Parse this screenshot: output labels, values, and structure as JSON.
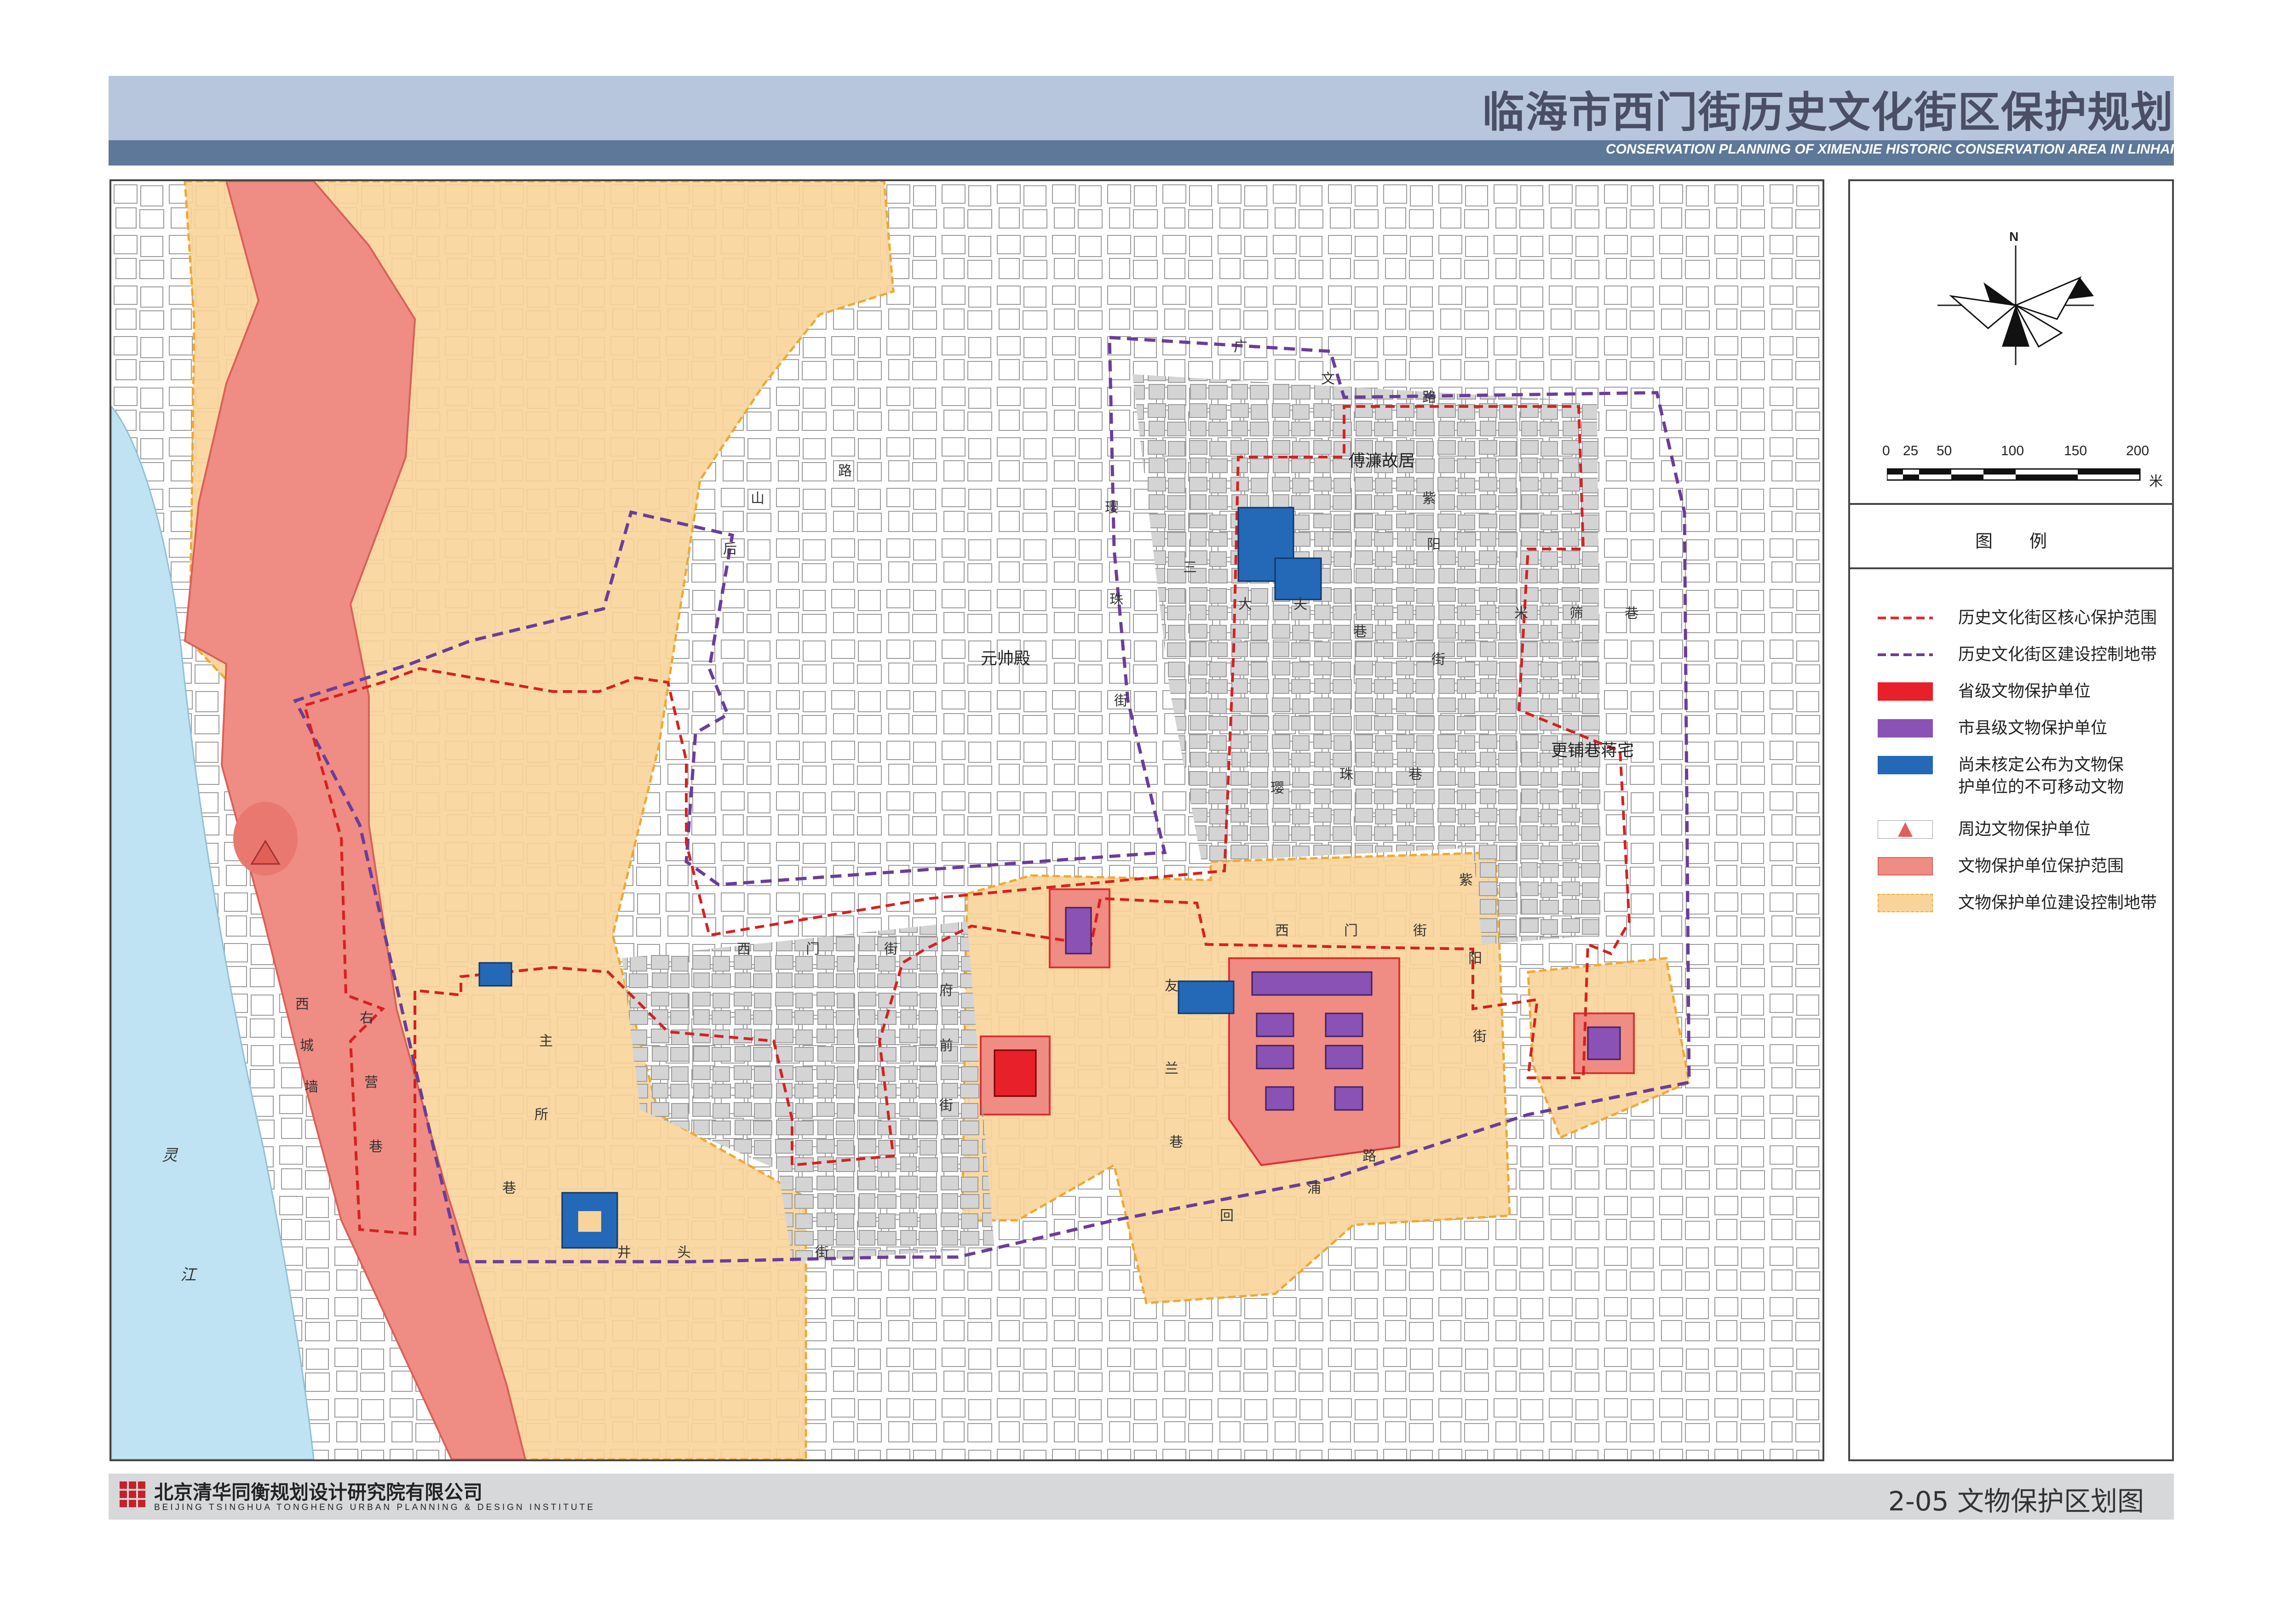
{
  "header": {
    "title": "临海市西门街历史文化街区保护规划",
    "subtitle": "CONSERVATION PLANNING OF XIMENJIE HISTORIC CONSERVATION AREA IN LINHAI"
  },
  "map": {
    "north_label": "N",
    "scale": {
      "ticks": [
        "0",
        "25",
        "50",
        "100",
        "150",
        "200"
      ],
      "unit": "米"
    },
    "place_labels": {
      "yuanshuaidian": "元帅殿",
      "fulianguju": "傅濂故居",
      "gengpuxiang_residence": "更铺巷蒋宅"
    },
    "street_chars": {
      "guangwenlu": [
        "广",
        "文",
        "路"
      ],
      "houshanlu": [
        "山",
        "后",
        "路"
      ],
      "yingzhujie": [
        "璎",
        "珠",
        "街"
      ],
      "sandafuxiang": [
        "三",
        "大",
        "夫",
        "巷"
      ],
      "ziyangjie_n": [
        "紫",
        "阳",
        "街"
      ],
      "migengxiang": [
        "米",
        "筛",
        "巷"
      ],
      "yingzhuxiang": [
        "璎",
        "珠",
        "巷"
      ],
      "ximenjie": [
        "西",
        "门",
        "街"
      ],
      "ziyangjie_s": [
        "紫",
        "阳",
        "街"
      ],
      "xichengqiang": [
        "西",
        "城",
        "墙"
      ],
      "youyingxiang": [
        "右",
        "营",
        "巷"
      ],
      "zhusuoxiang": [
        "主",
        "所",
        "巷"
      ],
      "jingtoujie": [
        "井",
        "头",
        "街"
      ],
      "fuqianjie": [
        "府",
        "前",
        "街"
      ],
      "youlanxiang": [
        "友",
        "兰",
        "巷"
      ],
      "huipulu": [
        "回",
        "浦",
        "路"
      ],
      "ximenjie_w": [
        "西",
        "门",
        "街"
      ],
      "lingjiang": [
        "灵",
        "江"
      ]
    }
  },
  "legend": {
    "title": "图例",
    "items": [
      {
        "label": "历史文化街区核心保护范围",
        "symbol": "red-dashed-line",
        "color": "#e03030"
      },
      {
        "label": "历史文化街区建设控制地带",
        "symbol": "purple-dashed-line",
        "color": "#6a3d9a"
      },
      {
        "label": "省级文物保护单位",
        "symbol": "fill",
        "color": "#e8202a"
      },
      {
        "label": "市县级文物保护单位",
        "symbol": "fill",
        "color": "#8a52b5"
      },
      {
        "label": "尚未核定公布为文物保护单位的不可移动文物",
        "symbol": "fill",
        "color": "#2468b8"
      },
      {
        "label": "周边文物保护单位",
        "symbol": "triangle",
        "color": "#e06058"
      },
      {
        "label": "文物保护单位保护范围",
        "symbol": "fill",
        "color": "#ef8c84"
      },
      {
        "label": "文物保护单位建设控制地带",
        "symbol": "fill",
        "color": "#f8d49a"
      }
    ]
  },
  "footer": {
    "institute": "北京清华同衡规划设计研究院有限公司",
    "institute_en": "BEIJING TSINGHUA TONGHENG URBAN PLANNING & DESIGN INSTITUTE",
    "figure": "2-05 文物保护区划图"
  }
}
